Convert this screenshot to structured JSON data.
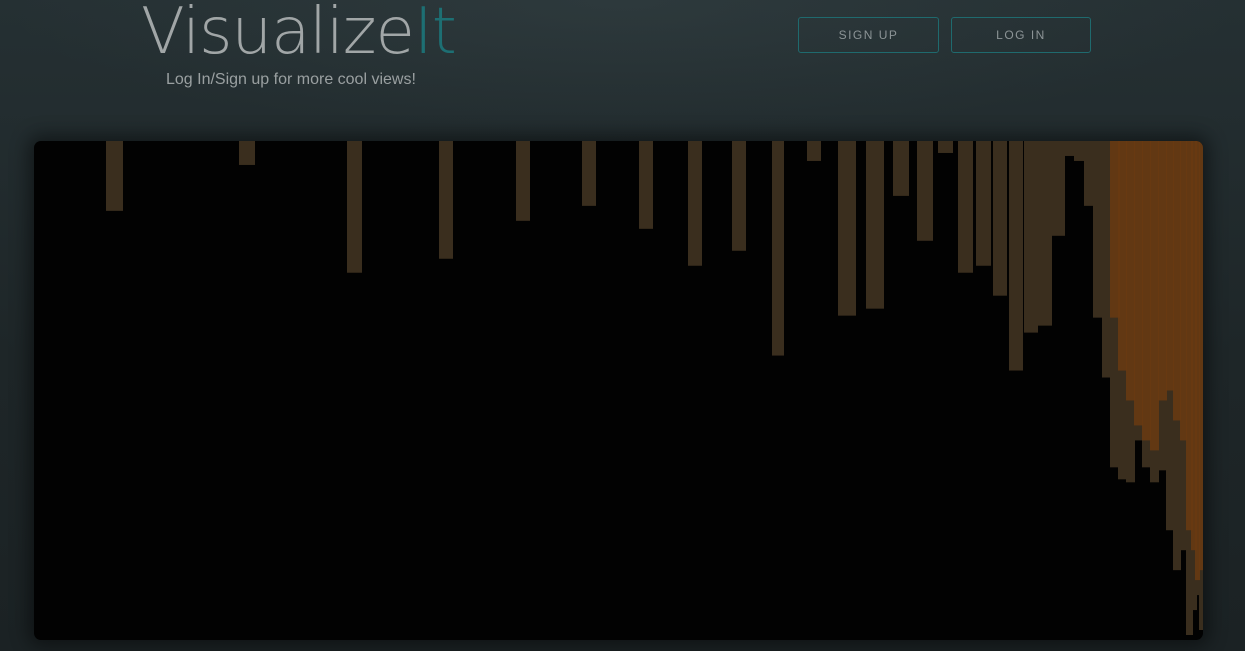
{
  "app": {
    "logo_main": "Visualize",
    "logo_accent": "It",
    "tagline": "Log In/Sign up for more cool views!"
  },
  "nav": {
    "signup_label": "SIGN UP",
    "login_label": "LOG IN"
  },
  "colors": {
    "accent": "#1d6f73",
    "canvas_background": "#020202",
    "page_background": "#222b2d"
  },
  "chart_data": {
    "type": "bar",
    "orientation": "top-down",
    "grid": false,
    "legend": "none",
    "ylim": [
      0,
      500
    ],
    "series": [
      {
        "color": "#3a2e1e",
        "values": [
          70,
          24,
          132,
          118,
          80,
          65,
          88,
          125,
          110,
          215,
          20,
          175,
          168,
          55,
          100,
          12,
          132,
          125,
          155,
          230,
          192,
          185,
          95,
          15,
          20,
          65,
          177,
          237,
          327,
          339,
          342,
          300,
          327,
          342,
          330,
          390,
          430,
          410,
          495,
          470,
          455,
          490
        ]
      },
      {
        "color": "#6a3a12",
        "values": [
          0,
          0,
          0,
          0,
          0,
          0,
          0,
          0,
          0,
          0,
          0,
          0,
          0,
          0,
          0,
          0,
          0,
          0,
          0,
          0,
          0,
          0,
          0,
          0,
          0,
          0,
          0,
          0,
          177,
          230,
          260,
          285,
          300,
          310,
          260,
          250,
          280,
          300,
          390,
          410,
          440,
          430
        ]
      }
    ]
  }
}
